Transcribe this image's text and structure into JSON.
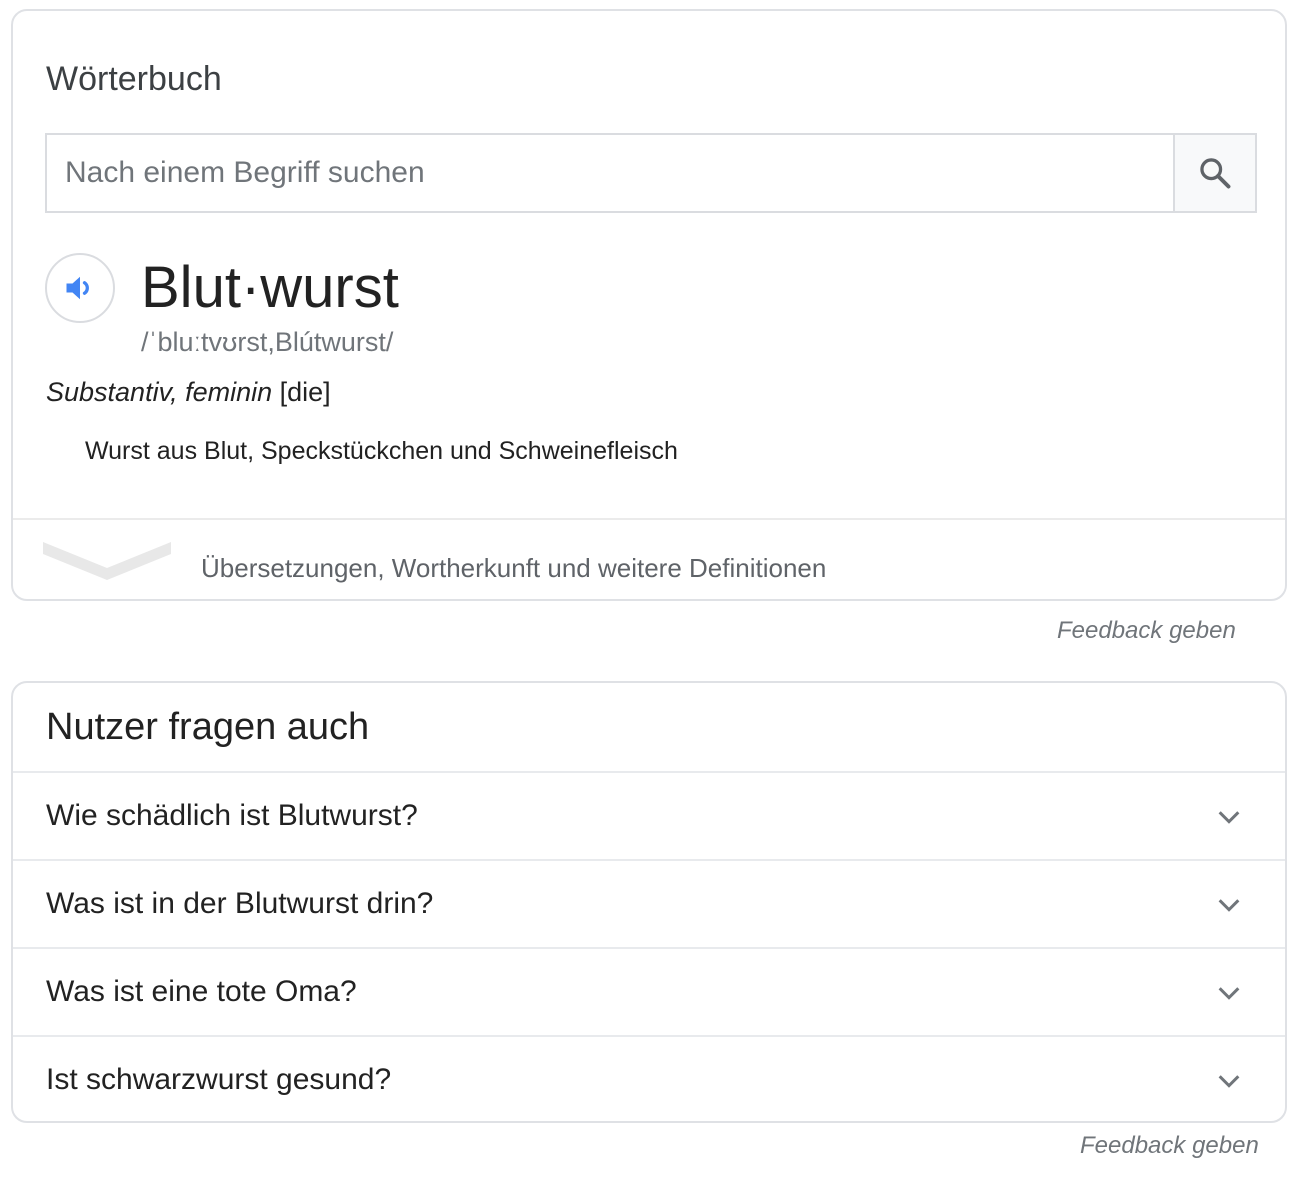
{
  "dictionary": {
    "title": "Wörterbuch",
    "search": {
      "placeholder": "Nach einem Begriff suchen",
      "value": "",
      "button_icon": "search-icon"
    },
    "entry": {
      "audio_icon": "speaker-icon",
      "headword": "Blut·wurst",
      "phonetic": "/ˈbluːtvʊrst,Blútwurst/",
      "part_of_speech": "Substantiv, feminin",
      "article": "[die]",
      "definition": "Wurst aus Blut, Speckstückchen und Schweinefleisch"
    },
    "more": {
      "icon": "chevron-down-icon",
      "label": "Übersetzungen, Wortherkunft und weitere Definitionen"
    },
    "feedback": "Feedback geben"
  },
  "people_also_ask": {
    "title": "Nutzer fragen auch",
    "questions": [
      "Wie schädlich ist Blutwurst?",
      "Was ist in der Blutwurst drin?",
      "Was ist eine tote Oma?",
      "Ist schwarzwurst gesund?"
    ],
    "feedback": "Feedback geben"
  },
  "colors": {
    "accent_blue": "#4285f4",
    "border": "#dfe1e5",
    "muted_text": "#70757a"
  }
}
